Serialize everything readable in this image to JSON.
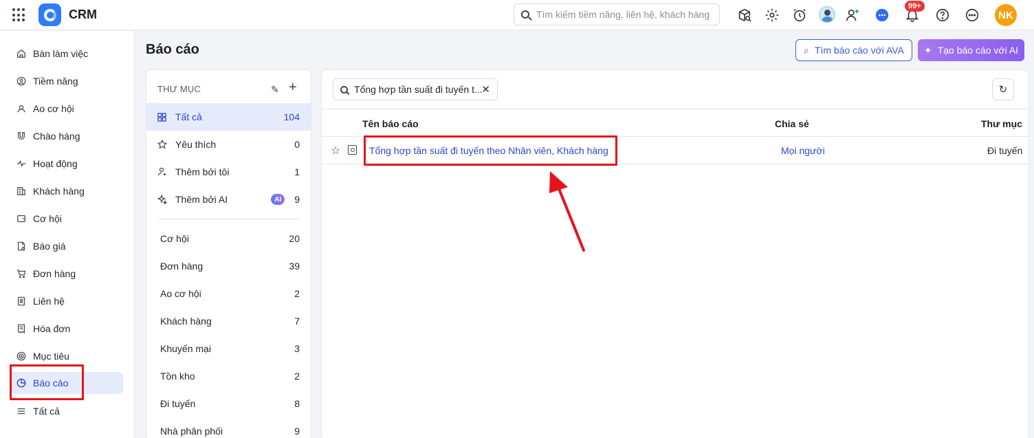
{
  "topbar": {
    "app_title": "CRM",
    "search_placeholder": "Tìm kiếm tiềm năng, liên hệ, khách hàng",
    "notification_count": "99+",
    "user_initials": "NK",
    "icons": [
      "apps-grid-icon",
      "crm-logo-icon",
      "box-search-icon",
      "gear-icon",
      "alarm-clock-icon",
      "user-avatar",
      "add-user-icon",
      "chat-icon",
      "bell-icon",
      "help-icon",
      "more-icon"
    ]
  },
  "sidebar": {
    "items": [
      {
        "label": "Bàn làm việc",
        "icon": "home-icon"
      },
      {
        "label": "Tiềm năng",
        "icon": "target-user-icon"
      },
      {
        "label": "Ao cơ hội",
        "icon": "users-icon"
      },
      {
        "label": "Chào hàng",
        "icon": "magnet-icon"
      },
      {
        "label": "Hoạt động",
        "icon": "activity-icon"
      },
      {
        "label": "Khách hàng",
        "icon": "building-icon"
      },
      {
        "label": "Cơ hội",
        "icon": "wallet-icon"
      },
      {
        "label": "Báo giá",
        "icon": "quote-doc-icon"
      },
      {
        "label": "Đơn hàng",
        "icon": "cart-icon"
      },
      {
        "label": "Liên hệ",
        "icon": "contact-book-icon"
      },
      {
        "label": "Hóa đơn",
        "icon": "invoice-icon"
      },
      {
        "label": "Mục tiêu",
        "icon": "goal-icon"
      },
      {
        "label": "Báo cáo",
        "icon": "pie-chart-icon",
        "active": true
      },
      {
        "label": "Tất cả",
        "icon": "menu-lines-icon"
      }
    ]
  },
  "page": {
    "title": "Báo cáo",
    "btn_ava": "Tìm báo cáo với AVA",
    "btn_ai": "Tạo báo cáo với AI"
  },
  "folders": {
    "header": "THƯ MỤC",
    "top": [
      {
        "label": "Tất cả",
        "count": "104",
        "icon": "grid-icon",
        "active": true
      },
      {
        "label": "Yêu thích",
        "count": "0",
        "icon": "star-icon"
      },
      {
        "label": "Thêm bởi tôi",
        "count": "1",
        "icon": "add-user-icon"
      },
      {
        "label": "Thêm bởi AI",
        "count": "9",
        "icon": "sparkle-icon",
        "badge": "AI"
      }
    ],
    "list": [
      {
        "label": "Cơ hội",
        "count": "20"
      },
      {
        "label": "Đơn hàng",
        "count": "39"
      },
      {
        "label": "Ao cơ hội",
        "count": "2"
      },
      {
        "label": "Khách hàng",
        "count": "7"
      },
      {
        "label": "Khuyến mại",
        "count": "3"
      },
      {
        "label": "Tồn kho",
        "count": "2"
      },
      {
        "label": "Đi tuyến",
        "count": "8"
      },
      {
        "label": "Nhà phân phối",
        "count": "9"
      }
    ]
  },
  "report_table": {
    "search_chip": "Tổng hợp tần suất đi tuyến t...",
    "columns": [
      "Tên báo cáo",
      "Chia sẻ",
      "Thư mục"
    ],
    "rows": [
      {
        "name": "Tổng hợp tần suất đi tuyến theo Nhân viên, Khách hàng",
        "share": "Mọi người",
        "folder": "Đi tuyến"
      }
    ]
  },
  "annotation_color": "#e3151a",
  "accent_color": "#2648d1"
}
